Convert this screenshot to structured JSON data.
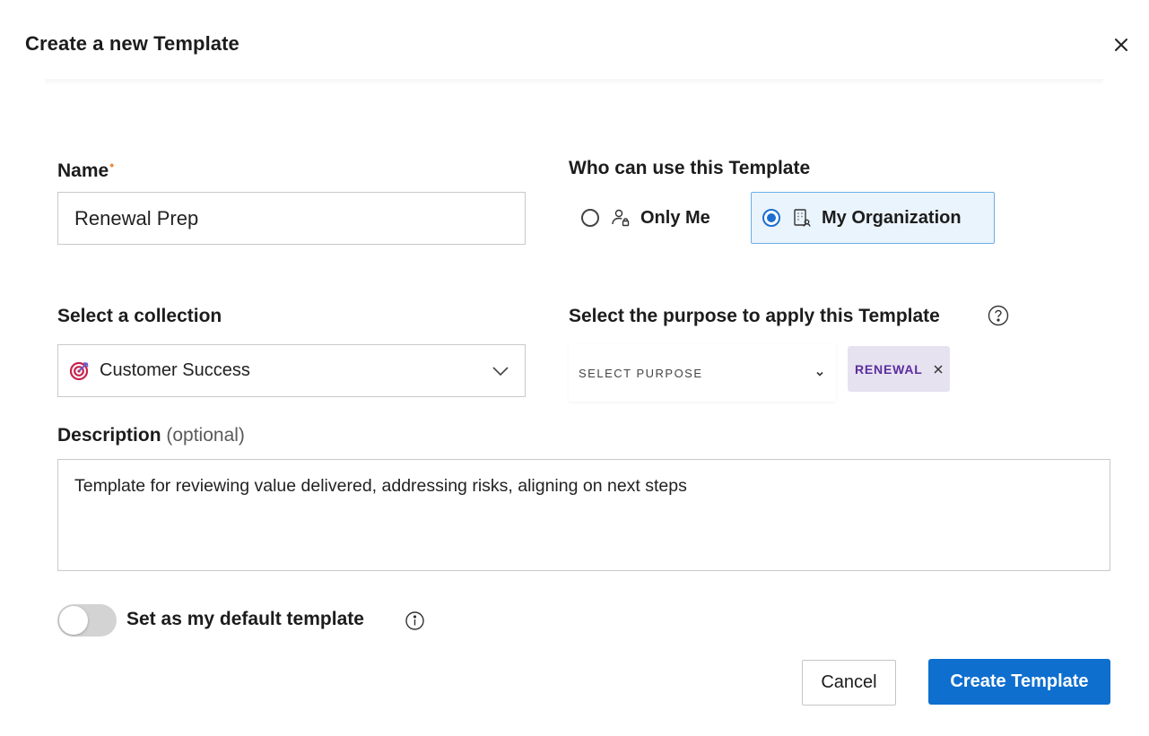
{
  "dialog": {
    "title": "Create a new Template",
    "close_icon": "close-icon"
  },
  "name_field": {
    "label": "Name",
    "required_marker": "•",
    "value": "Renewal Prep"
  },
  "visibility": {
    "label": "Who can use this Template",
    "options": [
      {
        "label": "Only Me",
        "icon": "person-lock-icon",
        "selected": false
      },
      {
        "label": "My Organization",
        "icon": "organization-icon",
        "selected": true
      }
    ]
  },
  "collection": {
    "label": "Select a collection",
    "value": "Customer Success",
    "icon": "target-icon"
  },
  "purpose": {
    "label": "Select the purpose to apply this Template",
    "placeholder": "SELECT PURPOSE",
    "help_icon": "question-circle-icon",
    "chips": [
      {
        "label": "RENEWAL"
      }
    ]
  },
  "description": {
    "label": "Description",
    "optional_note": "(optional)",
    "value": "Template for reviewing value delivered, addressing risks, aligning on next steps"
  },
  "default_toggle": {
    "label": "Set as my default template",
    "enabled": false,
    "info_icon": "info-circle-icon"
  },
  "actions": {
    "cancel_label": "Cancel",
    "create_label": "Create Template"
  },
  "colors": {
    "primary": "#0e6fcf",
    "selected_bg": "#eaf4fd",
    "required": "#f08a3c",
    "chip_bg": "#e6e2f0",
    "chip_text": "#5b2d9e"
  }
}
